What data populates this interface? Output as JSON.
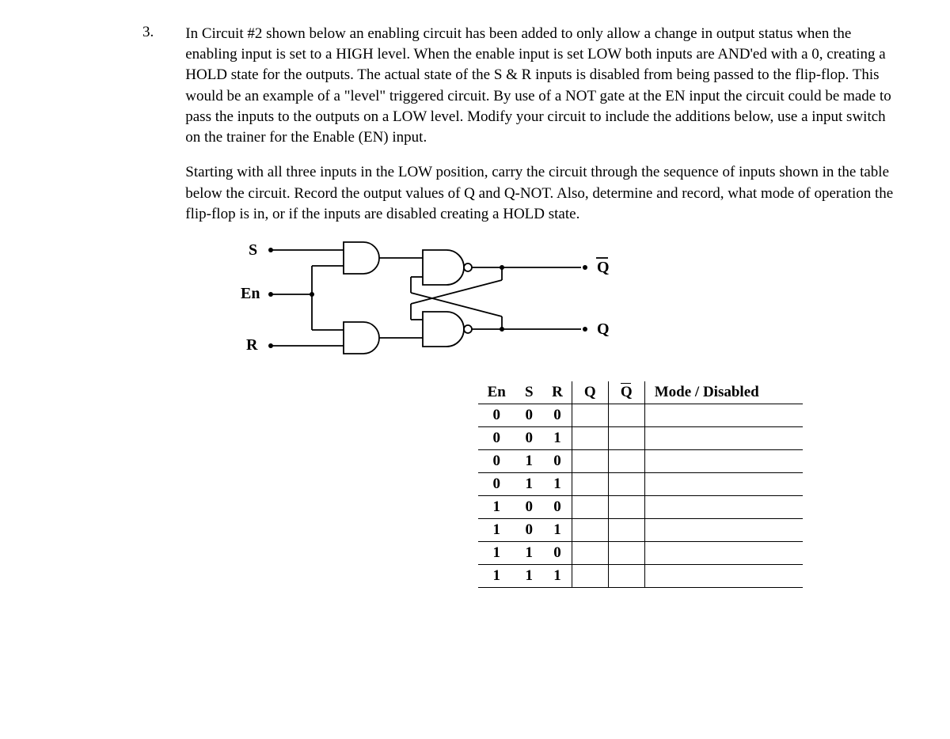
{
  "question_number": "3.",
  "para1": "In Circuit #2 shown below an enabling circuit has been added to only allow a change in output status when the enabling input is set to a HIGH level.  When the enable input is set LOW both inputs are AND'ed with a 0, creating a HOLD state for the outputs.  The actual state of the S & R inputs is disabled from being passed to the flip-flop.  This would be an example of a \"level\" triggered circuit.  By use of a NOT gate at the EN input the circuit could be made to pass the inputs to the outputs on a LOW   level.  Modify your circuit to include the additions below, use a input switch on the  trainer for the  Enable (EN) input.",
  "para2": "Starting with all three inputs in the LOW position, carry the circuit through the sequence of inputs shown in the table below the circuit.  Record the output values of Q and Q-NOT.    Also, determine and record, what mode of operation the flip-flop is in, or if the inputs are disabled creating a HOLD state.",
  "circuit": {
    "input_s": "S",
    "input_en": "En",
    "input_r": "R",
    "output_q": "Q",
    "output_qbar": "Q"
  },
  "table": {
    "headers": {
      "en": "En",
      "s": "S",
      "r": "R",
      "q": "Q",
      "qbar": "Q",
      "mode": "Mode / Disabled"
    },
    "rows": [
      {
        "en": "0",
        "s": "0",
        "r": "0",
        "q": "",
        "qbar": "",
        "mode": ""
      },
      {
        "en": "0",
        "s": "0",
        "r": "1",
        "q": "",
        "qbar": "",
        "mode": ""
      },
      {
        "en": "0",
        "s": "1",
        "r": "0",
        "q": "",
        "qbar": "",
        "mode": ""
      },
      {
        "en": "0",
        "s": "1",
        "r": "1",
        "q": "",
        "qbar": "",
        "mode": ""
      },
      {
        "en": "1",
        "s": "0",
        "r": "0",
        "q": "",
        "qbar": "",
        "mode": ""
      },
      {
        "en": "1",
        "s": "0",
        "r": "1",
        "q": "",
        "qbar": "",
        "mode": ""
      },
      {
        "en": "1",
        "s": "1",
        "r": "0",
        "q": "",
        "qbar": "",
        "mode": ""
      },
      {
        "en": "1",
        "s": "1",
        "r": "1",
        "q": "",
        "qbar": "",
        "mode": ""
      }
    ]
  }
}
